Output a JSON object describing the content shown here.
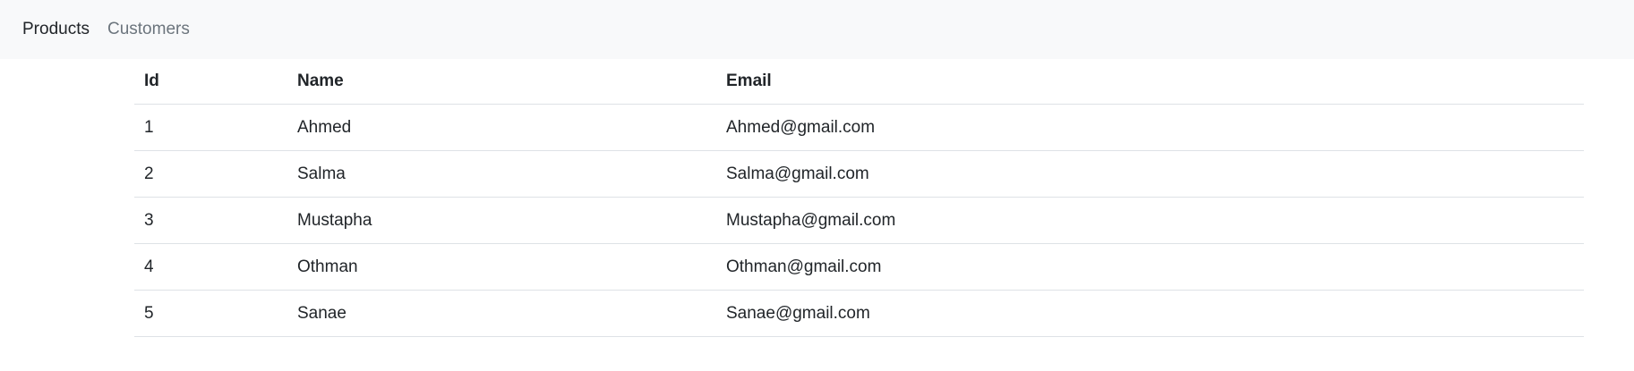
{
  "nav": {
    "items": [
      {
        "label": "Products",
        "state": "active"
      },
      {
        "label": "Customers",
        "state": "inactive"
      }
    ]
  },
  "table": {
    "headers": {
      "id": "Id",
      "name": "Name",
      "email": "Email"
    },
    "rows": [
      {
        "id": "1",
        "name": "Ahmed",
        "email": "Ahmed@gmail.com"
      },
      {
        "id": "2",
        "name": "Salma",
        "email": "Salma@gmail.com"
      },
      {
        "id": "3",
        "name": "Mustapha",
        "email": "Mustapha@gmail.com"
      },
      {
        "id": "4",
        "name": "Othman",
        "email": "Othman@gmail.com"
      },
      {
        "id": "5",
        "name": "Sanae",
        "email": "Sanae@gmail.com"
      }
    ]
  }
}
